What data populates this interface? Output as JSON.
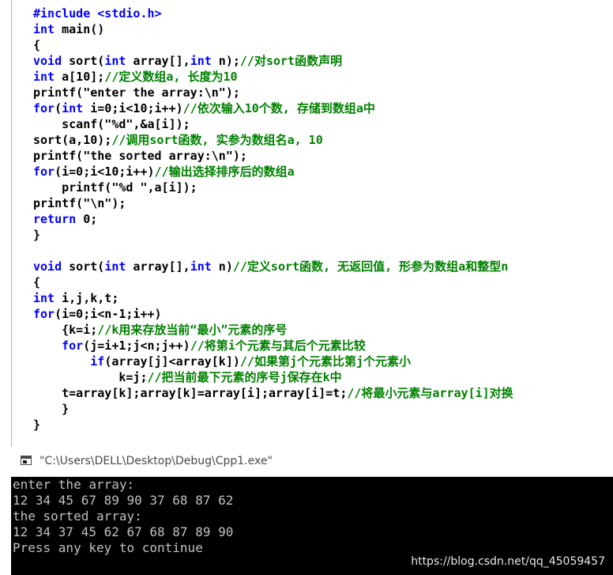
{
  "editor": {
    "lines": [
      [
        {
          "t": "#include <stdio.h>",
          "s": "kw"
        }
      ],
      [
        {
          "t": "int",
          "s": "kw"
        },
        {
          "t": " main()",
          "s": "n"
        }
      ],
      [
        {
          "t": "{",
          "s": "n"
        }
      ],
      [
        {
          "t": "void",
          "s": "kw"
        },
        {
          "t": " sort(",
          "s": "n"
        },
        {
          "t": "int",
          "s": "kw"
        },
        {
          "t": " array[],",
          "s": "n"
        },
        {
          "t": "int",
          "s": "kw"
        },
        {
          "t": " n);",
          "s": "n"
        },
        {
          "t": "//对sort函数声明",
          "s": "c"
        }
      ],
      [
        {
          "t": "int",
          "s": "kw"
        },
        {
          "t": " a[10];",
          "s": "n"
        },
        {
          "t": "//定义数组a, 长度为10",
          "s": "c"
        }
      ],
      [
        {
          "t": "printf(\"enter the array:\\n\");",
          "s": "n"
        }
      ],
      [
        {
          "t": "for",
          "s": "kw"
        },
        {
          "t": "(",
          "s": "n"
        },
        {
          "t": "int",
          "s": "kw"
        },
        {
          "t": " i=0;i<10;i++)",
          "s": "n"
        },
        {
          "t": "//依次输入10个数, 存储到数组a中",
          "s": "c"
        }
      ],
      [
        {
          "t": "    scanf(\"%d\",&a[i]);",
          "s": "n"
        }
      ],
      [
        {
          "t": "sort(a,10);",
          "s": "n"
        },
        {
          "t": "//调用sort函数, 实参为数组名a, 10",
          "s": "c"
        }
      ],
      [
        {
          "t": "printf(\"the sorted array:\\n\");",
          "s": "n"
        }
      ],
      [
        {
          "t": "for",
          "s": "kw"
        },
        {
          "t": "(i=0;i<10;i++)",
          "s": "n"
        },
        {
          "t": "//输出选择排序后的数组a",
          "s": "c"
        }
      ],
      [
        {
          "t": "    printf(\"%d \",a[i]);",
          "s": "n"
        }
      ],
      [
        {
          "t": "printf(\"\\n\");",
          "s": "n"
        }
      ],
      [
        {
          "t": "return",
          "s": "kw"
        },
        {
          "t": " 0;",
          "s": "n"
        }
      ],
      [
        {
          "t": "}",
          "s": "n"
        }
      ],
      [],
      [
        {
          "t": "void",
          "s": "kw"
        },
        {
          "t": " sort(",
          "s": "n"
        },
        {
          "t": "int",
          "s": "kw"
        },
        {
          "t": " array[],",
          "s": "n"
        },
        {
          "t": "int",
          "s": "kw"
        },
        {
          "t": " n)",
          "s": "n"
        },
        {
          "t": "//定义sort函数, 无返回值, 形参为数组a和整型n",
          "s": "c"
        }
      ],
      [
        {
          "t": "{",
          "s": "n"
        }
      ],
      [
        {
          "t": "int",
          "s": "kw"
        },
        {
          "t": " i,j,k,t;",
          "s": "n"
        }
      ],
      [
        {
          "t": "for",
          "s": "kw"
        },
        {
          "t": "(i=0;i<n-1;i++)",
          "s": "n"
        }
      ],
      [
        {
          "t": "    {k=i;",
          "s": "n"
        },
        {
          "t": "//k用来存放当前“最小”元素的序号",
          "s": "c"
        }
      ],
      [
        {
          "t": "    ",
          "s": "n"
        },
        {
          "t": "for",
          "s": "kw"
        },
        {
          "t": "(j=i+1;j<n;j++)",
          "s": "n"
        },
        {
          "t": "//将第i个元素与其后个元素比较",
          "s": "c"
        }
      ],
      [
        {
          "t": "        ",
          "s": "n"
        },
        {
          "t": "if",
          "s": "kw"
        },
        {
          "t": "(array[j]<array[k])",
          "s": "n"
        },
        {
          "t": "//如果第j个元素比第j个元素小",
          "s": "c"
        }
      ],
      [
        {
          "t": "            k=j;",
          "s": "n"
        },
        {
          "t": "//把当前最下元素的序号j保存在k中",
          "s": "c"
        }
      ],
      [
        {
          "t": "    t=array[k];array[k]=array[i];array[i]=t;",
          "s": "n"
        },
        {
          "t": "//将最小元素与array[i]对换",
          "s": "c"
        }
      ],
      [
        {
          "t": "    }",
          "s": "n"
        }
      ],
      [
        {
          "t": "}",
          "s": "n"
        }
      ]
    ]
  },
  "console": {
    "title": "\"C:\\Users\\DELL\\Desktop\\Debug\\Cpp1.exe\"",
    "icon": "console-window-icon",
    "output_lines": [
      "enter the array:",
      "12 34 45 67 89 90 37 68 87 62",
      "the sorted array:",
      "12 34 37 45 62 67 68 87 89 90",
      "Press any key to continue"
    ]
  },
  "watermark": "https://blog.csdn.net/qq_45059457",
  "colors": {
    "keyword": "#0000ff",
    "comment": "#008000",
    "code_text": "#000000",
    "console_bg": "#000000",
    "console_text": "#c0c0c0"
  }
}
